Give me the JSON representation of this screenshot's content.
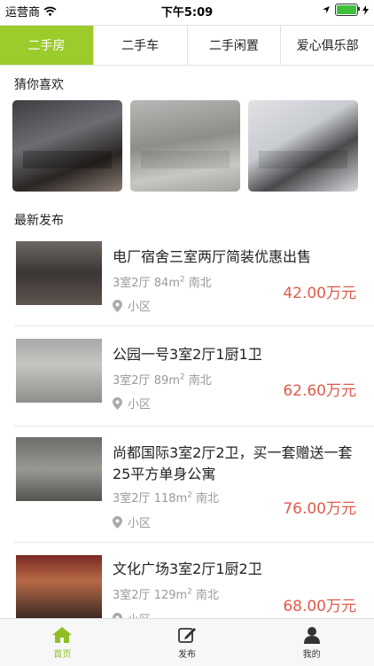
{
  "status_bar": {
    "carrier": "运营商",
    "time": "下午5:09"
  },
  "tabs": [
    {
      "label": "二手房",
      "active": true
    },
    {
      "label": "二手车",
      "active": false
    },
    {
      "label": "二手闲置",
      "active": false
    },
    {
      "label": "爱心俱乐部",
      "active": false
    }
  ],
  "sections": {
    "recommend_title": "猜你喜欢",
    "latest_title": "最新发布"
  },
  "listings": [
    {
      "title": "电厂宿舍三室两厅简装优惠出售",
      "layout": "3室2厅",
      "area": "84m",
      "area_sup": "2",
      "orientation": "南北",
      "location": "小区",
      "price": "42.00万元"
    },
    {
      "title": "公园一号3室2厅1厨1卫",
      "layout": "3室2厅",
      "area": "89m",
      "area_sup": "2",
      "orientation": "南北",
      "location": "小区",
      "price": "62.60万元"
    },
    {
      "title": "尚都国际3室2厅2卫，买一套赠送一套25平方单身公寓",
      "layout": "3室2厅",
      "area": "118m",
      "area_sup": "2",
      "orientation": "南北",
      "location": "小区",
      "price": "76.00万元"
    },
    {
      "title": "文化广场3室2厅1厨2卫",
      "layout": "3室2厅",
      "area": "129m",
      "area_sup": "2",
      "orientation": "南北",
      "location": "小区",
      "price": "68.00万元"
    }
  ],
  "bottom_nav": [
    {
      "label": "首页",
      "icon": "home-icon",
      "active": true
    },
    {
      "label": "发布",
      "icon": "edit-icon",
      "active": false
    },
    {
      "label": "我的",
      "icon": "user-icon",
      "active": false
    }
  ],
  "colors": {
    "accent": "#9ccb2c",
    "price": "#e05a4b",
    "battery": "#3dc13d"
  }
}
